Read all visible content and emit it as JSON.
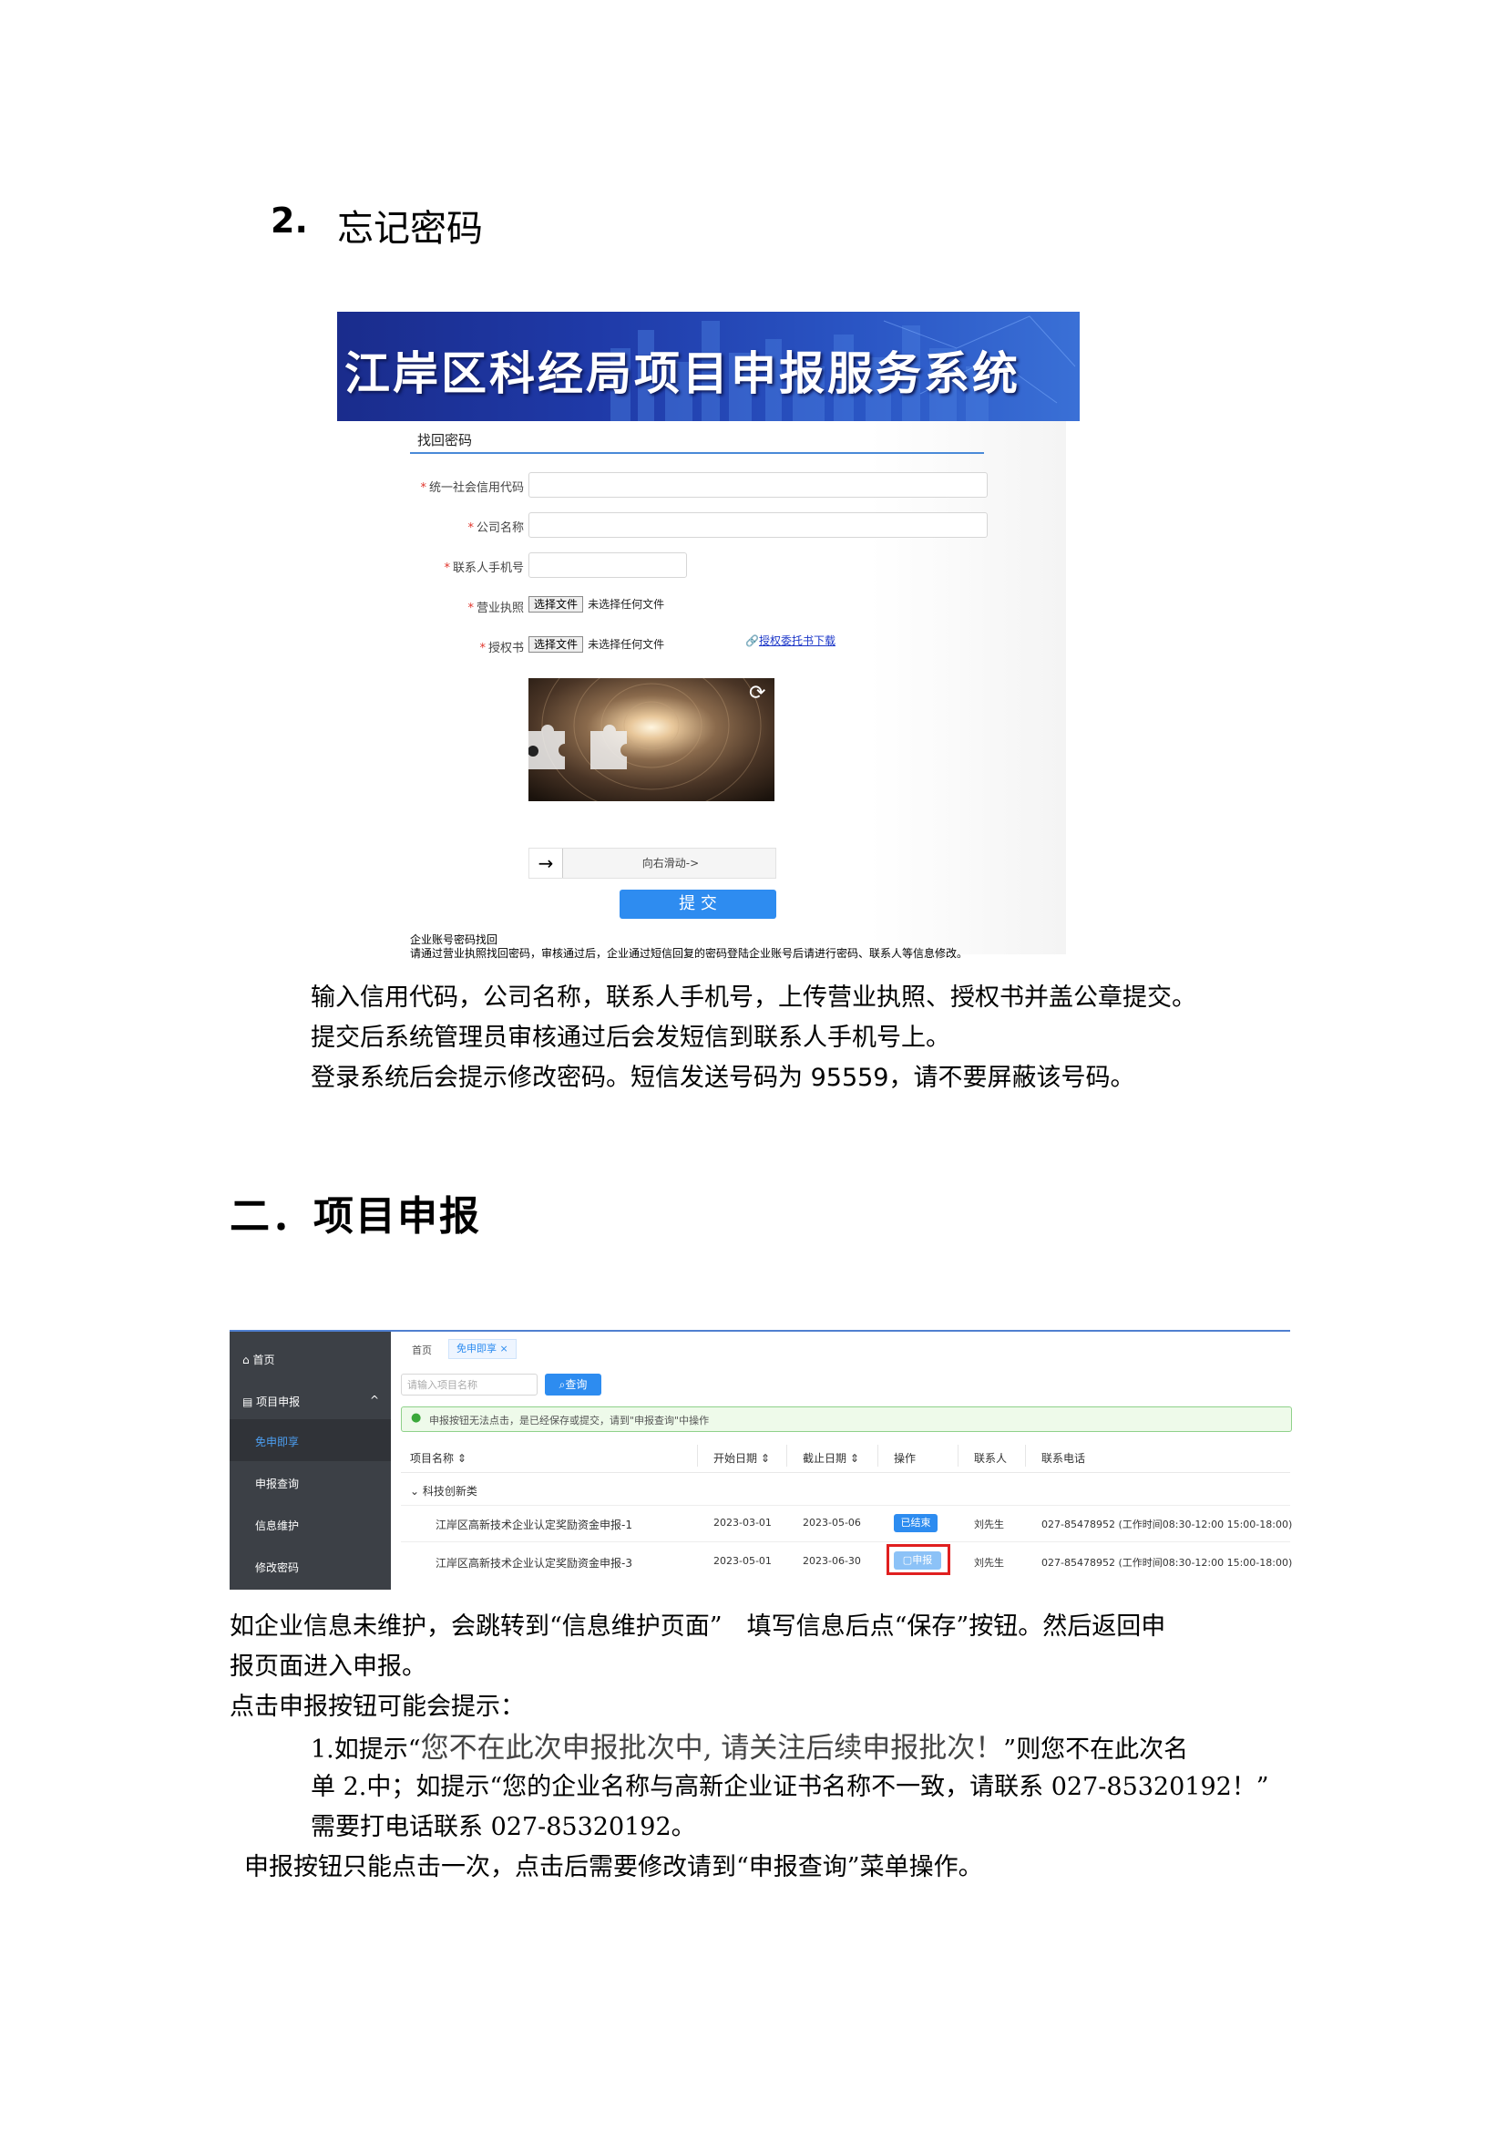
{
  "section1": {
    "number": "2.",
    "title": "忘记密码"
  },
  "shot1": {
    "banner_title": "江岸区科经局项目申报服务系统",
    "form_title": "找回密码",
    "fields": [
      {
        "label": "统一社会信用代码"
      },
      {
        "label": "公司名称"
      },
      {
        "label": "联系人手机号"
      }
    ],
    "business_license_label": "营业执照",
    "authorization_label": "授权书",
    "choose_file": "选择文件",
    "no_file": "未选择任何文件",
    "download_link": "授权委托书下载",
    "slide_hint": "向右滑动->",
    "submit": "提 交",
    "note_title": "企业账号密码找回",
    "note_text": "请通过营业执照找回密码，审核通过后，企业通过短信回复的密码登陆企业账号后请进行密码、联系人等信息修改。"
  },
  "paragraphs1": [
    "输入信用代码，公司名称，联系人手机号，上传营业执照、授权书并盖公章提交。",
    "提交后系统管理员审核通过后会发短信到联系人手机号上。"
  ],
  "para1_line3": {
    "pre": "登录系统后会提示修改密码。短信发送号码为 ",
    "num": "95559",
    "post": "，请不要屏蔽该号码。"
  },
  "section2": {
    "title": "二．项目申报"
  },
  "shot2": {
    "sidebar": {
      "home": "首页",
      "group": "项目申报",
      "items": [
        "免申即享",
        "申报查询",
        "信息维护",
        "修改密码"
      ]
    },
    "tabs": [
      "首页",
      "免申即享"
    ],
    "search_placeholder": "请输入项目名称",
    "search_button": "查询",
    "alert": "申报按钮无法点击，是已经保存或提交，请到\"申报查询\"中操作",
    "columns": [
      "项目名称",
      "开始日期",
      "截止日期",
      "操作",
      "联系人",
      "联系电话"
    ],
    "category": "科技创新类",
    "rows": [
      {
        "name": "江岸区高新技术企业认定奖励资金申报-1",
        "start": "2023-03-01",
        "end": "2023-05-06",
        "action": "已结束",
        "contact": "刘先生",
        "phone": "027-85478952 (工作时间08:30-12:00 15:00-18:00)"
      },
      {
        "name": "江岸区高新技术企业认定奖励资金申报-3",
        "start": "2023-05-01",
        "end": "2023-06-30",
        "action": "申报",
        "contact": "刘先生",
        "phone": "027-85478952 (工作时间08:30-12:00 15:00-18:00)"
      }
    ]
  },
  "paragraphs2": [
    "如企业信息未维护，会跳转到“信息维护页面”　填写信息后点“保存”按钮。然后返回申",
    "报页面进入申报。",
    "点击申报按钮可能会提示："
  ],
  "item1": {
    "prefix": "1.如提示“",
    "quote": "您不在此次申报批次中, 请关注后续申报批次！",
    "suffix": "”则您不在此次名"
  },
  "line_item2": "单 2.中；如提示“您的企业名称与高新企业证书名称不一致，请联系 027-85320192！”",
  "line_item2b": "需要打电话联系 027-85320192。",
  "last_line": "申报按钮只能点击一次，点击后需要修改请到“申报查询”菜单操作。"
}
